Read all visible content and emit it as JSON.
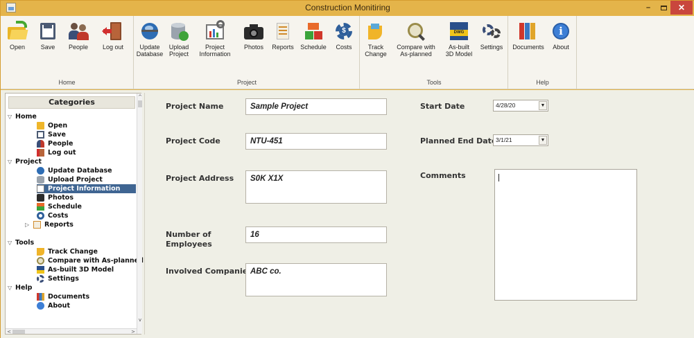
{
  "window": {
    "title": "Construction Monitiring",
    "minimize": "–",
    "close": "✕"
  },
  "ribbon": {
    "groups": [
      {
        "label": "Home"
      },
      {
        "label": "Project"
      },
      {
        "label": "Tools"
      },
      {
        "label": "Help"
      }
    ],
    "buttons": {
      "open": "Open",
      "save": "Save",
      "people": "People",
      "logout": "Log out",
      "update_database": "Update\nDatabase",
      "upload_project": "Upload\nProject",
      "project_information": "Project\nInformation",
      "photos": "Photos",
      "reports": "Reports",
      "schedule": "Schedule",
      "costs": "Costs",
      "track_change": "Track\nChange",
      "compare_as_planned": "Compare with\nAs-planned",
      "asbuilt_3d": "As-built\n3D Model",
      "settings": "Settings",
      "documents": "Documents",
      "about": "About"
    },
    "icon_badges": {
      "dwg": "DWG",
      "costs": "$",
      "about": "i"
    }
  },
  "tree": {
    "header": "Categories",
    "home": {
      "label": "Home",
      "items": [
        "Open",
        "Save",
        "People",
        "Log out"
      ]
    },
    "project": {
      "label": "Project",
      "items": [
        "Update Database",
        "Upload Project",
        "Project Information",
        "Photos",
        "Schedule",
        "Costs",
        "Reports"
      ],
      "selected": "Project Information"
    },
    "tools": {
      "label": "Tools",
      "items": [
        "Track Change",
        "Compare with As-planned",
        "As-built 3D Model",
        "Settings"
      ]
    },
    "help": {
      "label": "Help",
      "items": [
        "Documents",
        "About"
      ]
    }
  },
  "form": {
    "project_name": {
      "label": "Project Name",
      "value": "Sample Project"
    },
    "project_code": {
      "label": "Project Code",
      "value": "NTU-451"
    },
    "project_address": {
      "label": "Project Address",
      "value": "S0K X1X"
    },
    "employees": {
      "label": "Number of\nEmployees",
      "value": "16"
    },
    "companies": {
      "label": "Involved Companies",
      "value": "ABC co."
    },
    "start_date": {
      "label": "Start Date",
      "value": "4/28/20"
    },
    "planned_end_date": {
      "label": "Planned End Date",
      "value": "3/1/21"
    },
    "comments": {
      "label": "Comments",
      "value": ""
    }
  },
  "colors": {
    "titlebar": "#e4b44a",
    "ribbon_bg": "#f6f4ee",
    "selected_row": "#3f6592",
    "close_button": "#c9463d",
    "form_bg": "#efefe6"
  }
}
